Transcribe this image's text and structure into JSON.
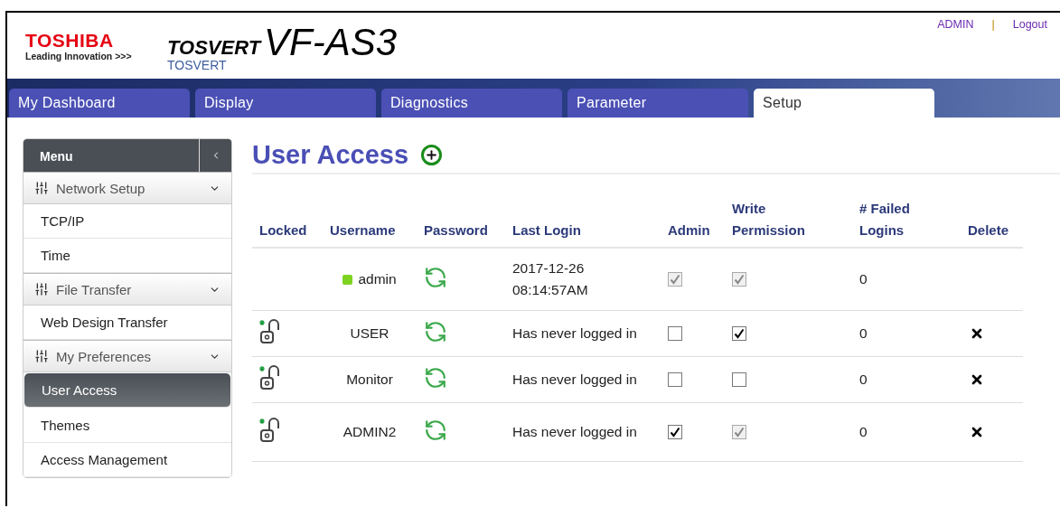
{
  "header": {
    "brand": "TOSHIBA",
    "tagline": "Leading Innovation >>>",
    "product_series": "TOSVERT",
    "product_model": "VF-AS3",
    "subtitle": "TOSVERT",
    "user": "ADMIN",
    "separator": "|",
    "logout": "Logout"
  },
  "tabs": [
    {
      "label": "My Dashboard",
      "selected": false
    },
    {
      "label": "Display",
      "selected": false
    },
    {
      "label": "Diagnostics",
      "selected": false
    },
    {
      "label": "Parameter",
      "selected": false
    },
    {
      "label": "Setup",
      "selected": true
    }
  ],
  "sidebar": {
    "title": "Menu",
    "groups": [
      {
        "label": "Network Setup",
        "expanded": true,
        "children": [
          {
            "label": "TCP/IP",
            "selected": false
          },
          {
            "label": "Time",
            "selected": false
          }
        ]
      },
      {
        "label": "File Transfer",
        "expanded": true,
        "children": [
          {
            "label": "Web Design Transfer",
            "selected": false
          }
        ]
      },
      {
        "label": "My Preferences",
        "expanded": true,
        "children": [
          {
            "label": "User Access",
            "selected": true
          },
          {
            "label": "Themes",
            "selected": false
          },
          {
            "label": "Access Management",
            "selected": false
          }
        ]
      }
    ]
  },
  "page_title": "User Access",
  "table": {
    "columns": [
      "Locked",
      "Username",
      "Password",
      "Last Login",
      "Admin",
      "Write Permission",
      "# Failed Logins",
      "Delete"
    ],
    "rows": [
      {
        "lock_shown": false,
        "online": true,
        "username": "admin",
        "last_login": "2017-12-26 08:14:57AM",
        "admin": {
          "checked": true,
          "disabled": true
        },
        "write": {
          "checked": true,
          "disabled": true
        },
        "failed": "0",
        "deletable": false
      },
      {
        "lock_shown": true,
        "online": false,
        "username": "USER",
        "last_login": "Has never logged in",
        "admin": {
          "checked": false,
          "disabled": false
        },
        "write": {
          "checked": true,
          "disabled": false
        },
        "failed": "0",
        "deletable": true
      },
      {
        "lock_shown": true,
        "online": false,
        "username": "Monitor",
        "last_login": "Has never logged in",
        "admin": {
          "checked": false,
          "disabled": false
        },
        "write": {
          "checked": false,
          "disabled": false
        },
        "failed": "0",
        "deletable": true
      },
      {
        "lock_shown": true,
        "online": false,
        "username": "ADMIN2",
        "last_login": "Has never logged in",
        "admin": {
          "checked": true,
          "disabled": false
        },
        "write": {
          "checked": true,
          "disabled": true
        },
        "failed": "0",
        "deletable": true
      }
    ]
  }
}
